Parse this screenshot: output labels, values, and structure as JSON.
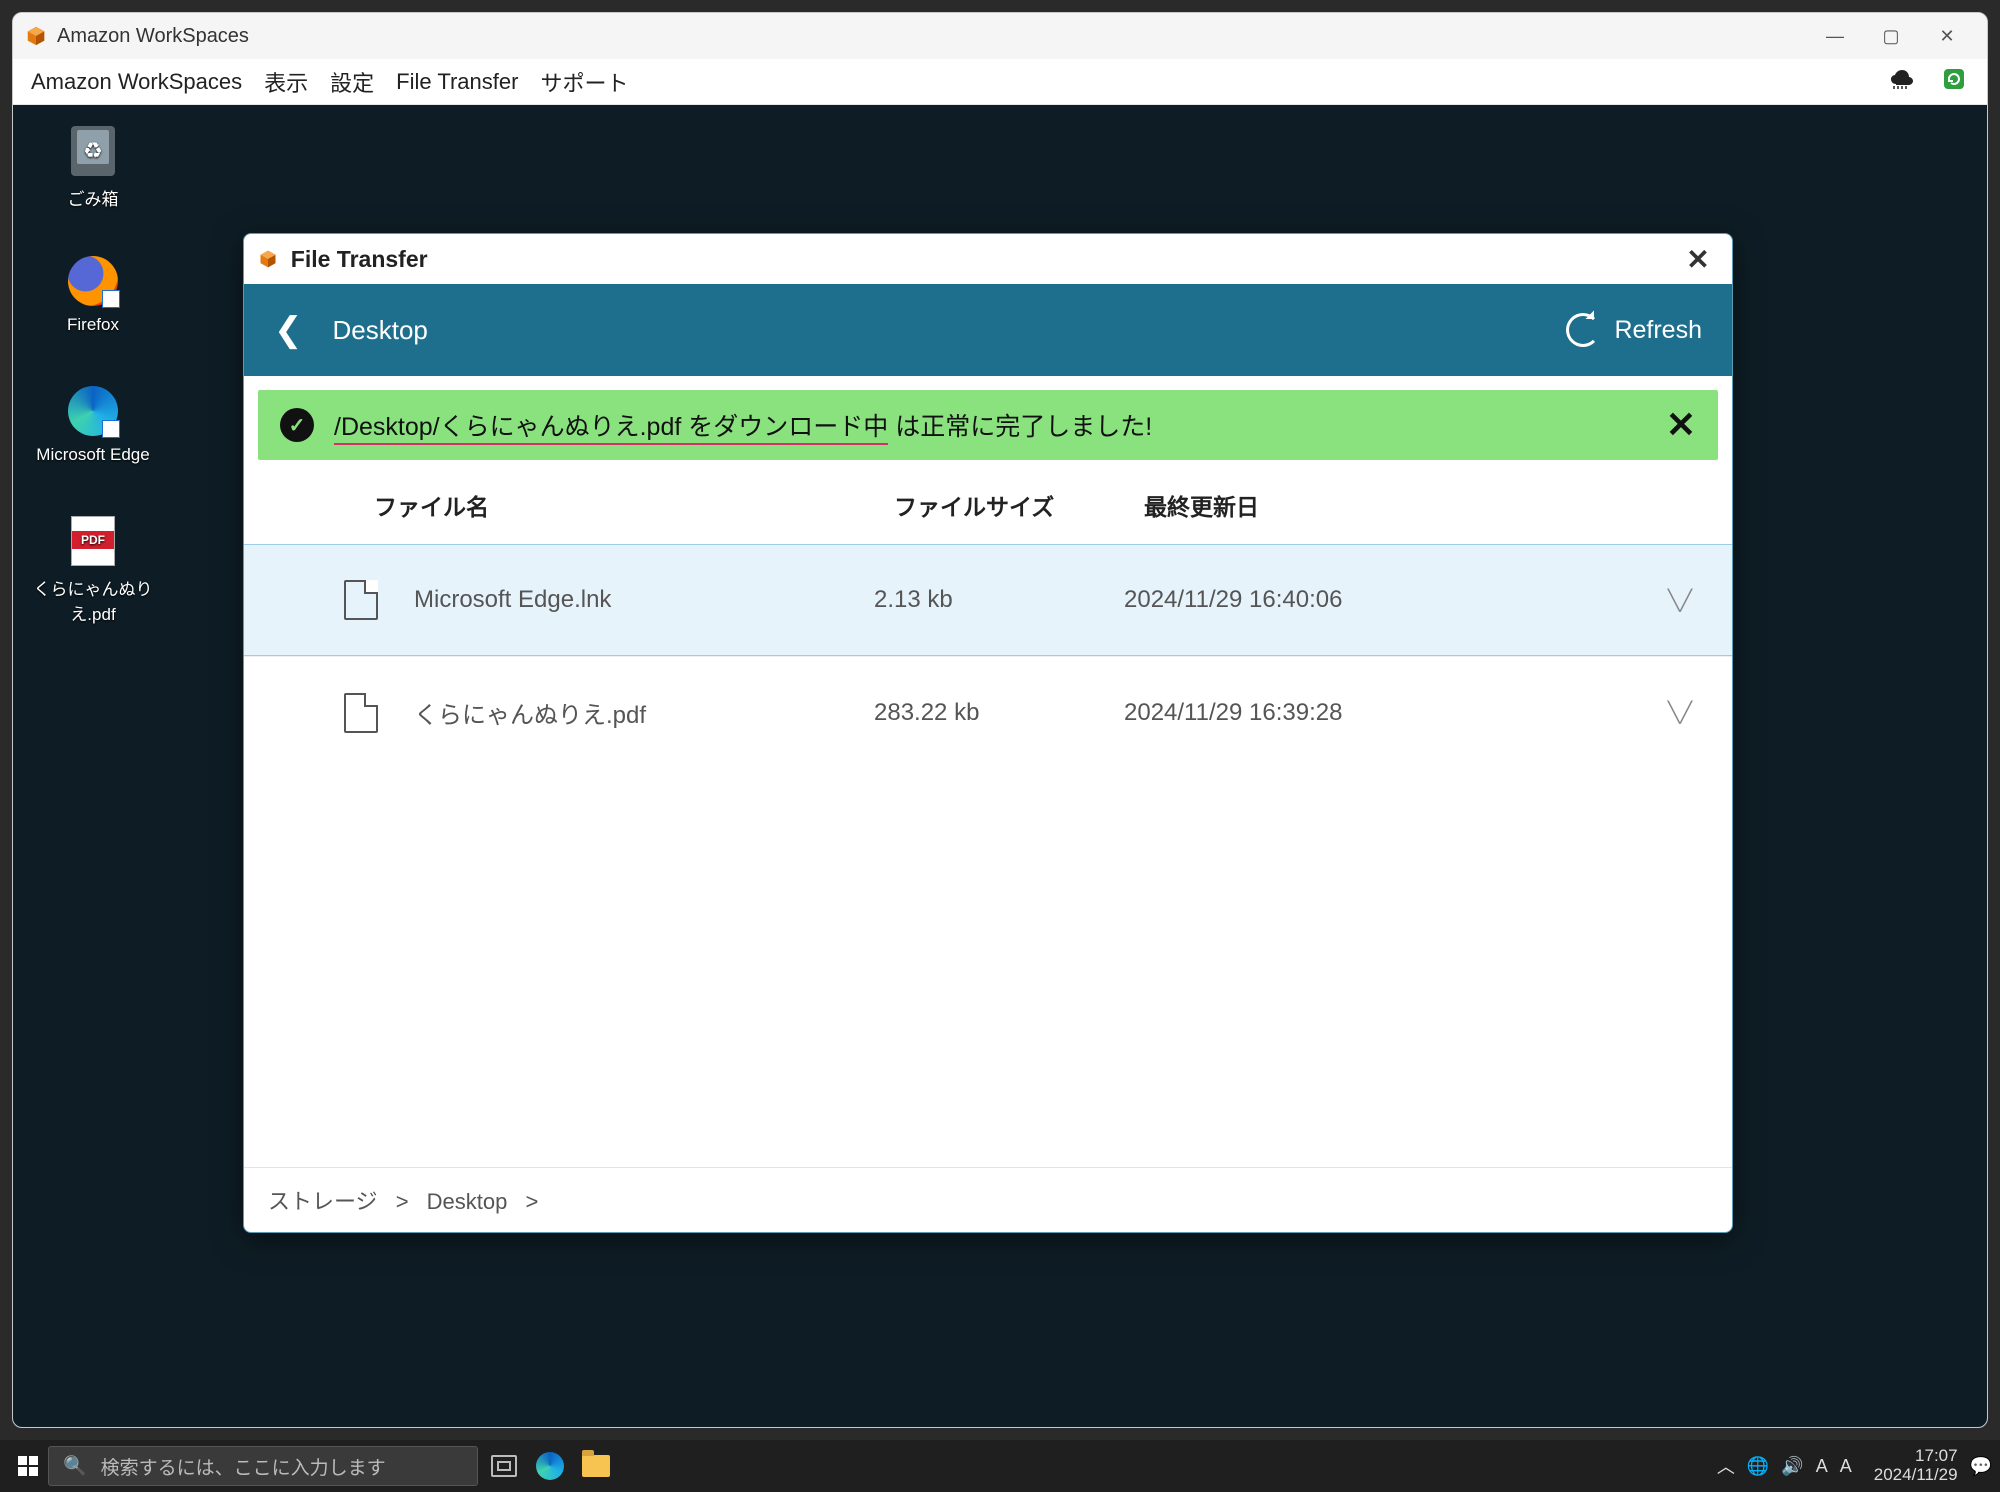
{
  "window": {
    "title": "Amazon WorkSpaces",
    "menu": [
      "Amazon WorkSpaces",
      "表示",
      "設定",
      "File Transfer",
      "サポート"
    ]
  },
  "desktop_icons": [
    {
      "id": "recycle",
      "label": "ごみ箱"
    },
    {
      "id": "firefox",
      "label": "Firefox"
    },
    {
      "id": "edge",
      "label": "Microsoft Edge"
    },
    {
      "id": "pdf",
      "label": "くらにゃんぬりえ.pdf"
    }
  ],
  "file_transfer": {
    "dialog_title": "File Transfer",
    "location": "Desktop",
    "refresh_label": "Refresh",
    "banner_path": "/Desktop/くらにゃんぬりえ.pdf をダウンロード中",
    "banner_status": " は正常に完了しました!",
    "columns": {
      "name": "ファイル名",
      "size": "ファイルサイズ",
      "date": "最終更新日"
    },
    "rows": [
      {
        "name": "Microsoft Edge.lnk",
        "size": "2.13 kb",
        "date": "2024/11/29 16:40:06",
        "selected": true
      },
      {
        "name": "くらにゃんぬりえ.pdf",
        "size": "283.22 kb",
        "date": "2024/11/29 16:39:28",
        "selected": false
      }
    ],
    "breadcrumb": [
      "ストレージ",
      "Desktop"
    ]
  },
  "taskbar": {
    "search_placeholder": "検索するには、ここに入力します",
    "ime": "A",
    "time": "17:07",
    "date": "2024/11/29"
  }
}
